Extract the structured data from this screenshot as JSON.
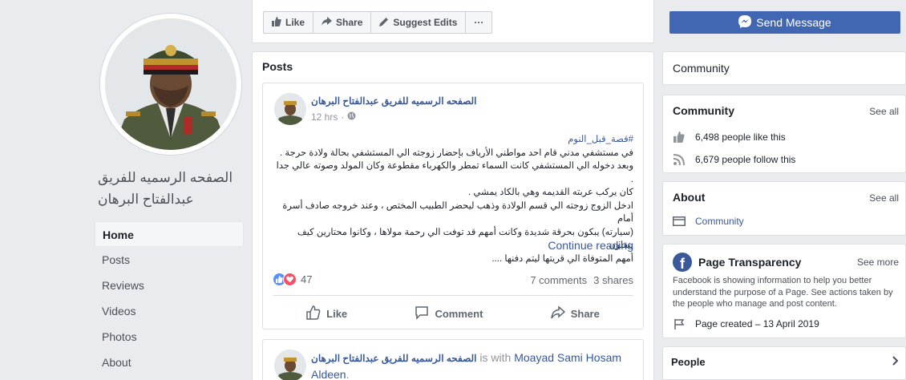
{
  "profile": {
    "name_line1": "الصفحه الرسميه للفريق",
    "name_line2": "عبدالفتاح البرهان"
  },
  "left_nav": {
    "items": [
      {
        "label": "Home"
      },
      {
        "label": "Posts"
      },
      {
        "label": "Reviews"
      },
      {
        "label": "Videos"
      },
      {
        "label": "Photos"
      },
      {
        "label": "About"
      }
    ]
  },
  "action_bar": {
    "like": "Like",
    "share": "Share",
    "suggest": "Suggest Edits",
    "more": "···",
    "send_message": "Send Message"
  },
  "posts": {
    "title": "Posts",
    "post1": {
      "author": "الصفحه الرسميه للفريق عبدالفتاح البرهان",
      "time": "12 hrs",
      "hashtag": "#قصة_قبل_النوم",
      "lines": [
        "في مستشفي مدني قام احد مواطني الأرياف بإحضار زوجته الي المستشفي بحالة ولادة حرجة .",
        "وبعد دخوله الي المستشفي كانت السماء تمطر والكهرباء مقطوعة وكان المولد وصوته عالي جدا .",
        "كان يركب عربته القديمه وهي بالكاد يمشي .",
        "ادخل الزوج زوجته الي قسم الولادة وذهب ليحضر الطبيب المختص ، وعند خروجه صادف أسرة أمام",
        "(سيارته) يبكون بحرقة شديدة وكانت أمهم قد توفت الي رحمة مولاها ، وكانوا محتارين كيف ينقلون",
        "أمهم المتوفاة الي قريتها ليتم دفنها ...."
      ],
      "continue": "Continue reading",
      "reaction_count": "47",
      "comments": "7 comments",
      "shares": "3 shares",
      "actions": {
        "like": "Like",
        "comment": "Comment",
        "share": "Share"
      }
    },
    "post2": {
      "author": "الصفحه الرسميه للفريق عبدالفتاح البرهان",
      "with_text": " is with ",
      "tagged": "Moayad Sami Hosam Aldeen",
      "period": "."
    }
  },
  "right": {
    "community_header": "Community",
    "community_card": {
      "title": "Community",
      "see_all": "See all",
      "likes": "6,498 people like this",
      "follows": "6,679 people follow this"
    },
    "about_card": {
      "title": "About",
      "see_all": "See all",
      "category": "Community"
    },
    "transparency_card": {
      "title": "Page Transparency",
      "see_more": "See more",
      "description": "Facebook is showing information to help you better understand the purpose of a Page. See actions taken by the people who manage and post content.",
      "created": "Page created – 13 April 2019"
    },
    "people_card": {
      "title": "People"
    }
  },
  "colors": {
    "brand": "#4267b2",
    "link": "#365899",
    "background": "#e9ebee"
  }
}
